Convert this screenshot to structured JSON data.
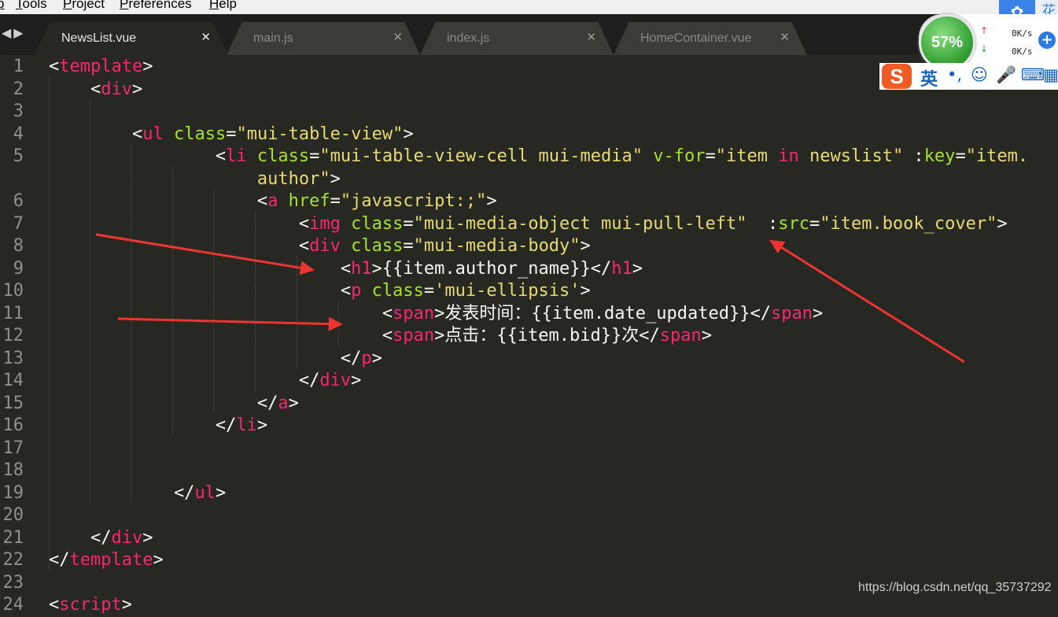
{
  "menu": [
    "p",
    "Tools",
    "Project",
    "Preferences",
    "Help"
  ],
  "tabs": [
    {
      "label": "NewsList.vue",
      "active": true
    },
    {
      "label": "main.js",
      "active": false
    },
    {
      "label": "index.js",
      "active": false
    },
    {
      "label": "HomeContainer.vue",
      "active": false
    }
  ],
  "tab_close_glyph": "✕",
  "nav_arrows": "◀▶",
  "colors": {
    "tag": "#f92672",
    "attr": "#a6e22e",
    "string": "#e6db74",
    "text": "#f8f8f2",
    "background": "#272822",
    "arrow": "#ee3333"
  },
  "code_lines": [
    {
      "n": "1",
      "tokens": [
        [
          "p",
          "<"
        ],
        [
          "tag",
          "template"
        ],
        [
          "p",
          ">"
        ]
      ]
    },
    {
      "n": "2",
      "tokens": [
        [
          "p",
          "    <"
        ],
        [
          "tag",
          "div"
        ],
        [
          "p",
          ">"
        ]
      ]
    },
    {
      "n": "3",
      "tokens": []
    },
    {
      "n": "4",
      "tokens": [
        [
          "p",
          "        <"
        ],
        [
          "tag",
          "ul"
        ],
        [
          "p",
          " "
        ],
        [
          "attr",
          "class"
        ],
        [
          "p",
          "="
        ],
        [
          "str",
          "\"mui-table-view\""
        ],
        [
          "p",
          ">"
        ]
      ]
    },
    {
      "n": "5",
      "tokens": [
        [
          "p",
          "                <"
        ],
        [
          "tag",
          "li"
        ],
        [
          "p",
          " "
        ],
        [
          "attr",
          "class"
        ],
        [
          "p",
          "="
        ],
        [
          "str",
          "\"mui-table-view-cell mui-media\""
        ],
        [
          "p",
          " "
        ],
        [
          "attr",
          "v-for"
        ],
        [
          "p",
          "="
        ],
        [
          "str",
          "\"item "
        ],
        [
          "tag",
          "in"
        ],
        [
          "str",
          " newslist\""
        ],
        [
          "p",
          " :"
        ],
        [
          "attr",
          "key"
        ],
        [
          "p",
          "="
        ],
        [
          "str",
          "\"item."
        ]
      ]
    },
    {
      "n": "",
      "tokens": [
        [
          "str",
          "                    author\""
        ],
        [
          "p",
          ">"
        ]
      ]
    },
    {
      "n": "6",
      "tokens": [
        [
          "p",
          "                    <"
        ],
        [
          "tag",
          "a"
        ],
        [
          "p",
          " "
        ],
        [
          "attr",
          "href"
        ],
        [
          "p",
          "="
        ],
        [
          "str",
          "\"javascript:;\""
        ],
        [
          "p",
          ">"
        ]
      ]
    },
    {
      "n": "7",
      "tokens": [
        [
          "p",
          "                        <"
        ],
        [
          "tag",
          "img"
        ],
        [
          "p",
          " "
        ],
        [
          "attr",
          "class"
        ],
        [
          "p",
          "="
        ],
        [
          "str",
          "\"mui-media-object mui-pull-left\""
        ],
        [
          "p",
          "  :"
        ],
        [
          "attr",
          "src"
        ],
        [
          "p",
          "="
        ],
        [
          "str",
          "\"item.book_cover\""
        ],
        [
          "p",
          ">"
        ]
      ]
    },
    {
      "n": "8",
      "tokens": [
        [
          "p",
          "                        <"
        ],
        [
          "tag",
          "div"
        ],
        [
          "p",
          " "
        ],
        [
          "attr",
          "class"
        ],
        [
          "p",
          "="
        ],
        [
          "str",
          "\"mui-media-body\""
        ],
        [
          "p",
          ">"
        ]
      ]
    },
    {
      "n": "9",
      "tokens": [
        [
          "p",
          "                            <"
        ],
        [
          "tag",
          "h1"
        ],
        [
          "p",
          ">{{item.author_name}}</"
        ],
        [
          "tag",
          "h1"
        ],
        [
          "p",
          ">"
        ]
      ]
    },
    {
      "n": "10",
      "tokens": [
        [
          "p",
          "                            <"
        ],
        [
          "tag",
          "p"
        ],
        [
          "p",
          " "
        ],
        [
          "attr",
          "class"
        ],
        [
          "p",
          "="
        ],
        [
          "str",
          "'mui-ellipsis'"
        ],
        [
          "p",
          ">"
        ]
      ]
    },
    {
      "n": "11",
      "tokens": [
        [
          "p",
          "                                <"
        ],
        [
          "tag",
          "span"
        ],
        [
          "p",
          ">发表时间：{{item.date_updated}}</"
        ],
        [
          "tag",
          "span"
        ],
        [
          "p",
          ">"
        ]
      ]
    },
    {
      "n": "12",
      "tokens": [
        [
          "p",
          "                                <"
        ],
        [
          "tag",
          "span"
        ],
        [
          "p",
          ">点击：{{item.bid}}次</"
        ],
        [
          "tag",
          "span"
        ],
        [
          "p",
          ">"
        ]
      ]
    },
    {
      "n": "13",
      "tokens": [
        [
          "p",
          "                            </"
        ],
        [
          "tag",
          "p"
        ],
        [
          "p",
          ">"
        ]
      ]
    },
    {
      "n": "14",
      "tokens": [
        [
          "p",
          "                        </"
        ],
        [
          "tag",
          "div"
        ],
        [
          "p",
          ">"
        ]
      ]
    },
    {
      "n": "15",
      "tokens": [
        [
          "p",
          "                    </"
        ],
        [
          "tag",
          "a"
        ],
        [
          "p",
          ">"
        ]
      ]
    },
    {
      "n": "16",
      "tokens": [
        [
          "p",
          "                </"
        ],
        [
          "tag",
          "li"
        ],
        [
          "p",
          ">"
        ]
      ]
    },
    {
      "n": "17",
      "tokens": []
    },
    {
      "n": "18",
      "tokens": []
    },
    {
      "n": "19",
      "tokens": [
        [
          "p",
          "            </"
        ],
        [
          "tag",
          "ul"
        ],
        [
          "p",
          ">"
        ]
      ]
    },
    {
      "n": "20",
      "tokens": []
    },
    {
      "n": "21",
      "tokens": [
        [
          "p",
          "    </"
        ],
        [
          "tag",
          "div"
        ],
        [
          "p",
          ">"
        ]
      ]
    },
    {
      "n": "22",
      "tokens": [
        [
          "p",
          "</"
        ],
        [
          "tag",
          "template"
        ],
        [
          "p",
          ">"
        ]
      ]
    },
    {
      "n": "23",
      "tokens": []
    },
    {
      "n": "24",
      "tokens": [
        [
          "p",
          "<"
        ],
        [
          "tag",
          "script"
        ],
        [
          "p",
          ">"
        ]
      ]
    }
  ],
  "net_widget": {
    "percent": "57%",
    "upload": "0K/s",
    "download": "0K/s",
    "up_arrow": "↑",
    "down_arrow": "↓",
    "plus": "+"
  },
  "baidu_icon": "✿",
  "corner_char": "花",
  "ime": {
    "logo": "S",
    "mode": "英",
    "punct": "•,",
    "emoji": "☺",
    "mic": "🎤",
    "keyboard": "⌨",
    "toolbox": "▦"
  },
  "watermark": "https://blog.csdn.net/qq_35737292"
}
